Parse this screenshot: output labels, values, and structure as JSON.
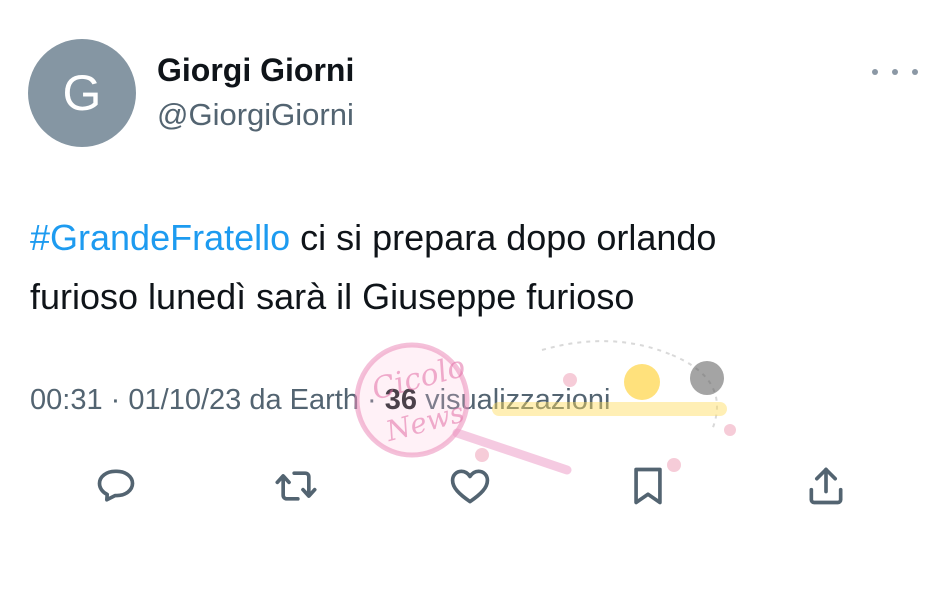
{
  "author": {
    "avatar_letter": "G",
    "display_name": "Giorgi Giorni",
    "handle": "@GiorgiGiorni"
  },
  "tweet": {
    "hashtag": "#GrandeFratello",
    "text_line1": " ci si prepara dopo orlando",
    "text_line2": "furioso lunedì sarà il Giuseppe furioso"
  },
  "meta": {
    "time": "00:31",
    "date": "01/10/23",
    "source": "da Earth",
    "separator": "·",
    "views_count": "36",
    "views_label": "visualizzazioni"
  },
  "watermark": {
    "text_line1": "Cicolo",
    "text_line2": "News"
  },
  "actions": {
    "reply_icon": "reply-icon",
    "retweet_icon": "retweet-icon",
    "like_icon": "like-icon",
    "bookmark_icon": "bookmark-icon",
    "share_icon": "share-icon"
  },
  "colors": {
    "link": "#1d9bf0",
    "secondary_text": "#536471",
    "primary_text": "#0f1419",
    "avatar_bg": "#8596a3",
    "icon": "#536471"
  }
}
